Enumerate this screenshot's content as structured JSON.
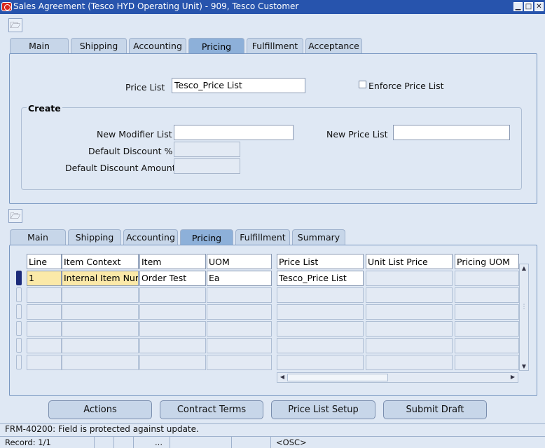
{
  "window": {
    "title": "Sales Agreement (Tesco HYD Operating Unit) - 909, Tesco Customer",
    "controls": [
      "minimize-icon",
      "maximize-icon",
      "close-icon"
    ]
  },
  "header_tabs": [
    "Main",
    "Shipping",
    "Accounting",
    "Pricing",
    "Fulfillment",
    "Acceptance"
  ],
  "header_active_tab": "Pricing",
  "pricing": {
    "price_list_label": "Price List",
    "price_list_value": "Tesco_Price List",
    "enforce_label": "Enforce Price List",
    "enforce_checked": false,
    "create_title": "Create",
    "new_modifier_label": "New Modifier List",
    "new_modifier_value": "",
    "default_discount_pct_label": "Default Discount %",
    "default_discount_pct_value": "",
    "default_discount_amt_label": "Default Discount Amount",
    "default_discount_amt_value": "",
    "new_price_list_label": "New Price List",
    "new_price_list_value": ""
  },
  "line_tabs": [
    "Main",
    "Shipping",
    "Accounting",
    "Pricing",
    "Fulfillment",
    "Summary"
  ],
  "line_active_tab": "Pricing",
  "lines": {
    "columns": [
      "Line",
      "Item Context",
      "Item",
      "UOM",
      "Price List",
      "Unit List Price",
      "Pricing UOM"
    ],
    "rows": [
      [
        "1",
        "Internal Item Number",
        "Order Test",
        "Ea",
        "Tesco_Price List",
        "",
        ""
      ],
      [
        "",
        "",
        "",
        "",
        "",
        "",
        ""
      ],
      [
        "",
        "",
        "",
        "",
        "",
        "",
        ""
      ],
      [
        "",
        "",
        "",
        "",
        "",
        "",
        ""
      ],
      [
        "",
        "",
        "",
        "",
        "",
        "",
        ""
      ],
      [
        "",
        "",
        "",
        "",
        "",
        "",
        ""
      ]
    ]
  },
  "buttons": {
    "actions": "Actions",
    "contract_terms": "Contract Terms",
    "price_list_setup": "Price List Setup",
    "submit_draft": "Submit Draft"
  },
  "status": {
    "message": "FRM-40200: Field is protected against update.",
    "record": "Record: 1/1",
    "ellipsis": "...",
    "osc": "<OSC>"
  },
  "colors": {
    "titlebar": "#2754ad",
    "active_tab": "#8db0d9",
    "required_field": "#fbe9a8",
    "background": "#dfe8f4"
  }
}
